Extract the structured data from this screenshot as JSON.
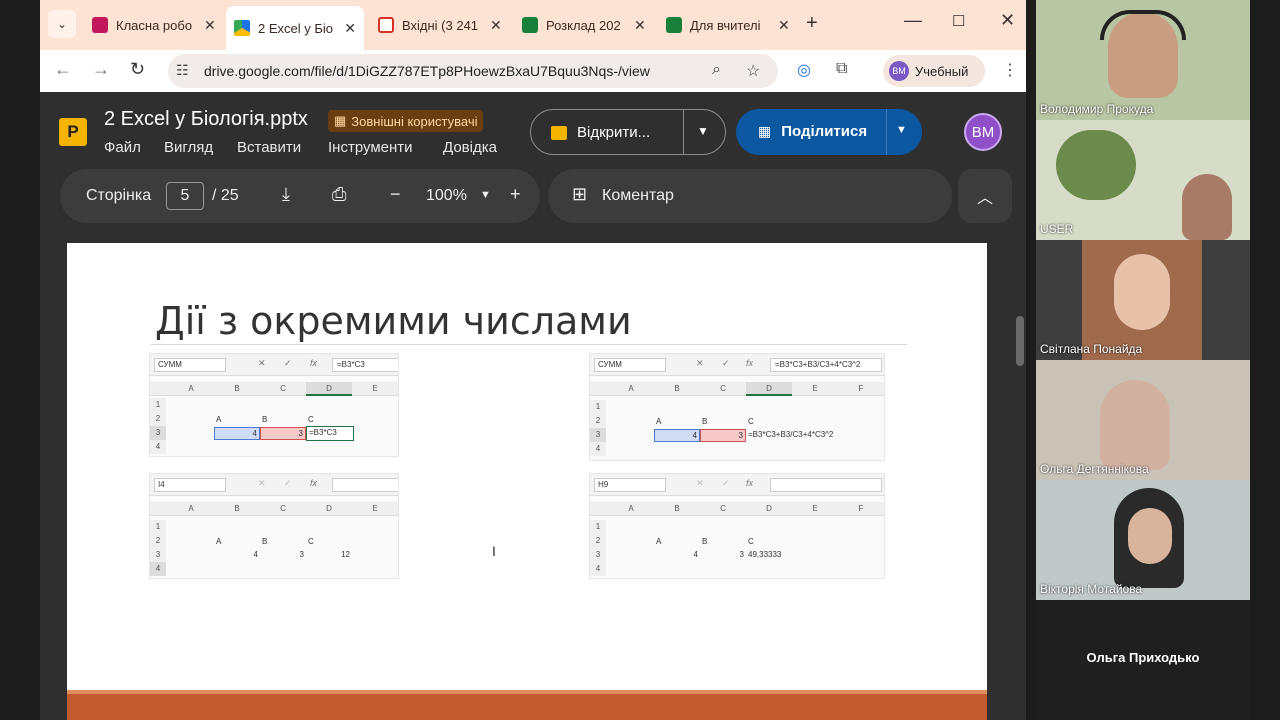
{
  "browser": {
    "tabs": [
      {
        "title": "Класна робо",
        "color": "#c2185b"
      },
      {
        "title": "2 Excel у Біо",
        "color": "#1a73e8",
        "active": true
      },
      {
        "title": "Вхідні (3 241",
        "color": "#d93025"
      },
      {
        "title": "Розклад 202",
        "color": "#188038"
      },
      {
        "title": "Для вчителі",
        "color": "#188038"
      }
    ],
    "url": "drive.google.com/file/d/1DiGZZ787ETp8PHoewzBxaU7Bquu3Nqs-/view",
    "profile_label": "Учебный",
    "profile_initials": "ВМ"
  },
  "viewer": {
    "file_name": "2 Excel у Біологія.pptx",
    "external_badge": "Зовнішні користувачі",
    "menu": [
      "Файл",
      "Вигляд",
      "Вставити",
      "Інструменти",
      "Довідка"
    ],
    "open_label": "Відкрити...",
    "share_label": "Поділитися",
    "avatar_initials": "ВМ",
    "page_label": "Сторінка",
    "page_current": "5",
    "page_total": "/ 25",
    "zoom": "100%",
    "comment_label": "Коментар"
  },
  "slide": {
    "title": "Дії з окремими числами",
    "snippets": [
      {
        "namebox": "СУММ",
        "formula": "=B3*C3",
        "cols": [
          "A",
          "B",
          "C",
          "D",
          "E"
        ],
        "rows": [
          "1",
          "2",
          "3",
          "4"
        ],
        "cells": {
          "r2b": "A",
          "r2c": "B",
          "r2d": "C",
          "r3c": "4",
          "r3d": "3",
          "r3e": "=B3*C3"
        }
      },
      {
        "namebox": "СУММ",
        "formula": "=B3*C3+B3/C3+4*C3^2",
        "cols": [
          "A",
          "B",
          "C",
          "D",
          "E",
          "F"
        ],
        "rows": [
          "1",
          "2",
          "3",
          "4"
        ],
        "cells": {
          "r2b": "A",
          "r2c": "B",
          "r2d": "C",
          "r3c": "4",
          "r3d": "3",
          "r3e": "=B3*C3+B3/C3+4*C3^2"
        }
      },
      {
        "namebox": "I4",
        "formula": "",
        "cols": [
          "A",
          "B",
          "C",
          "D",
          "E"
        ],
        "rows": [
          "1",
          "2",
          "3",
          "4"
        ],
        "cells": {
          "r2b": "A",
          "r2c": "B",
          "r2d": "C",
          "r3c": "4",
          "r3d": "3",
          "r3e": "12"
        }
      },
      {
        "namebox": "H9",
        "formula": "",
        "cols": [
          "A",
          "B",
          "C",
          "D",
          "E",
          "F"
        ],
        "rows": [
          "1",
          "2",
          "3",
          "4"
        ],
        "cells": {
          "r2b": "A",
          "r2c": "B",
          "r2d": "C",
          "r3c": "4",
          "r3d": "3",
          "r3e": "49,33333"
        }
      }
    ]
  },
  "participants": [
    {
      "name": "Володимир Прокуда",
      "bg": "#b9c6a3"
    },
    {
      "name": "USER",
      "bg": "#d7dcc8"
    },
    {
      "name": "Світлана Понайда",
      "bg": "#a06a4c"
    },
    {
      "name": "Ольга Дегтяннікова",
      "bg": "#c9c2b7"
    },
    {
      "name": "Вікторія Мотайова",
      "bg": "#bfc9c8"
    },
    {
      "name": "Ольга Приходько",
      "bg": "#1f1f1f"
    }
  ]
}
